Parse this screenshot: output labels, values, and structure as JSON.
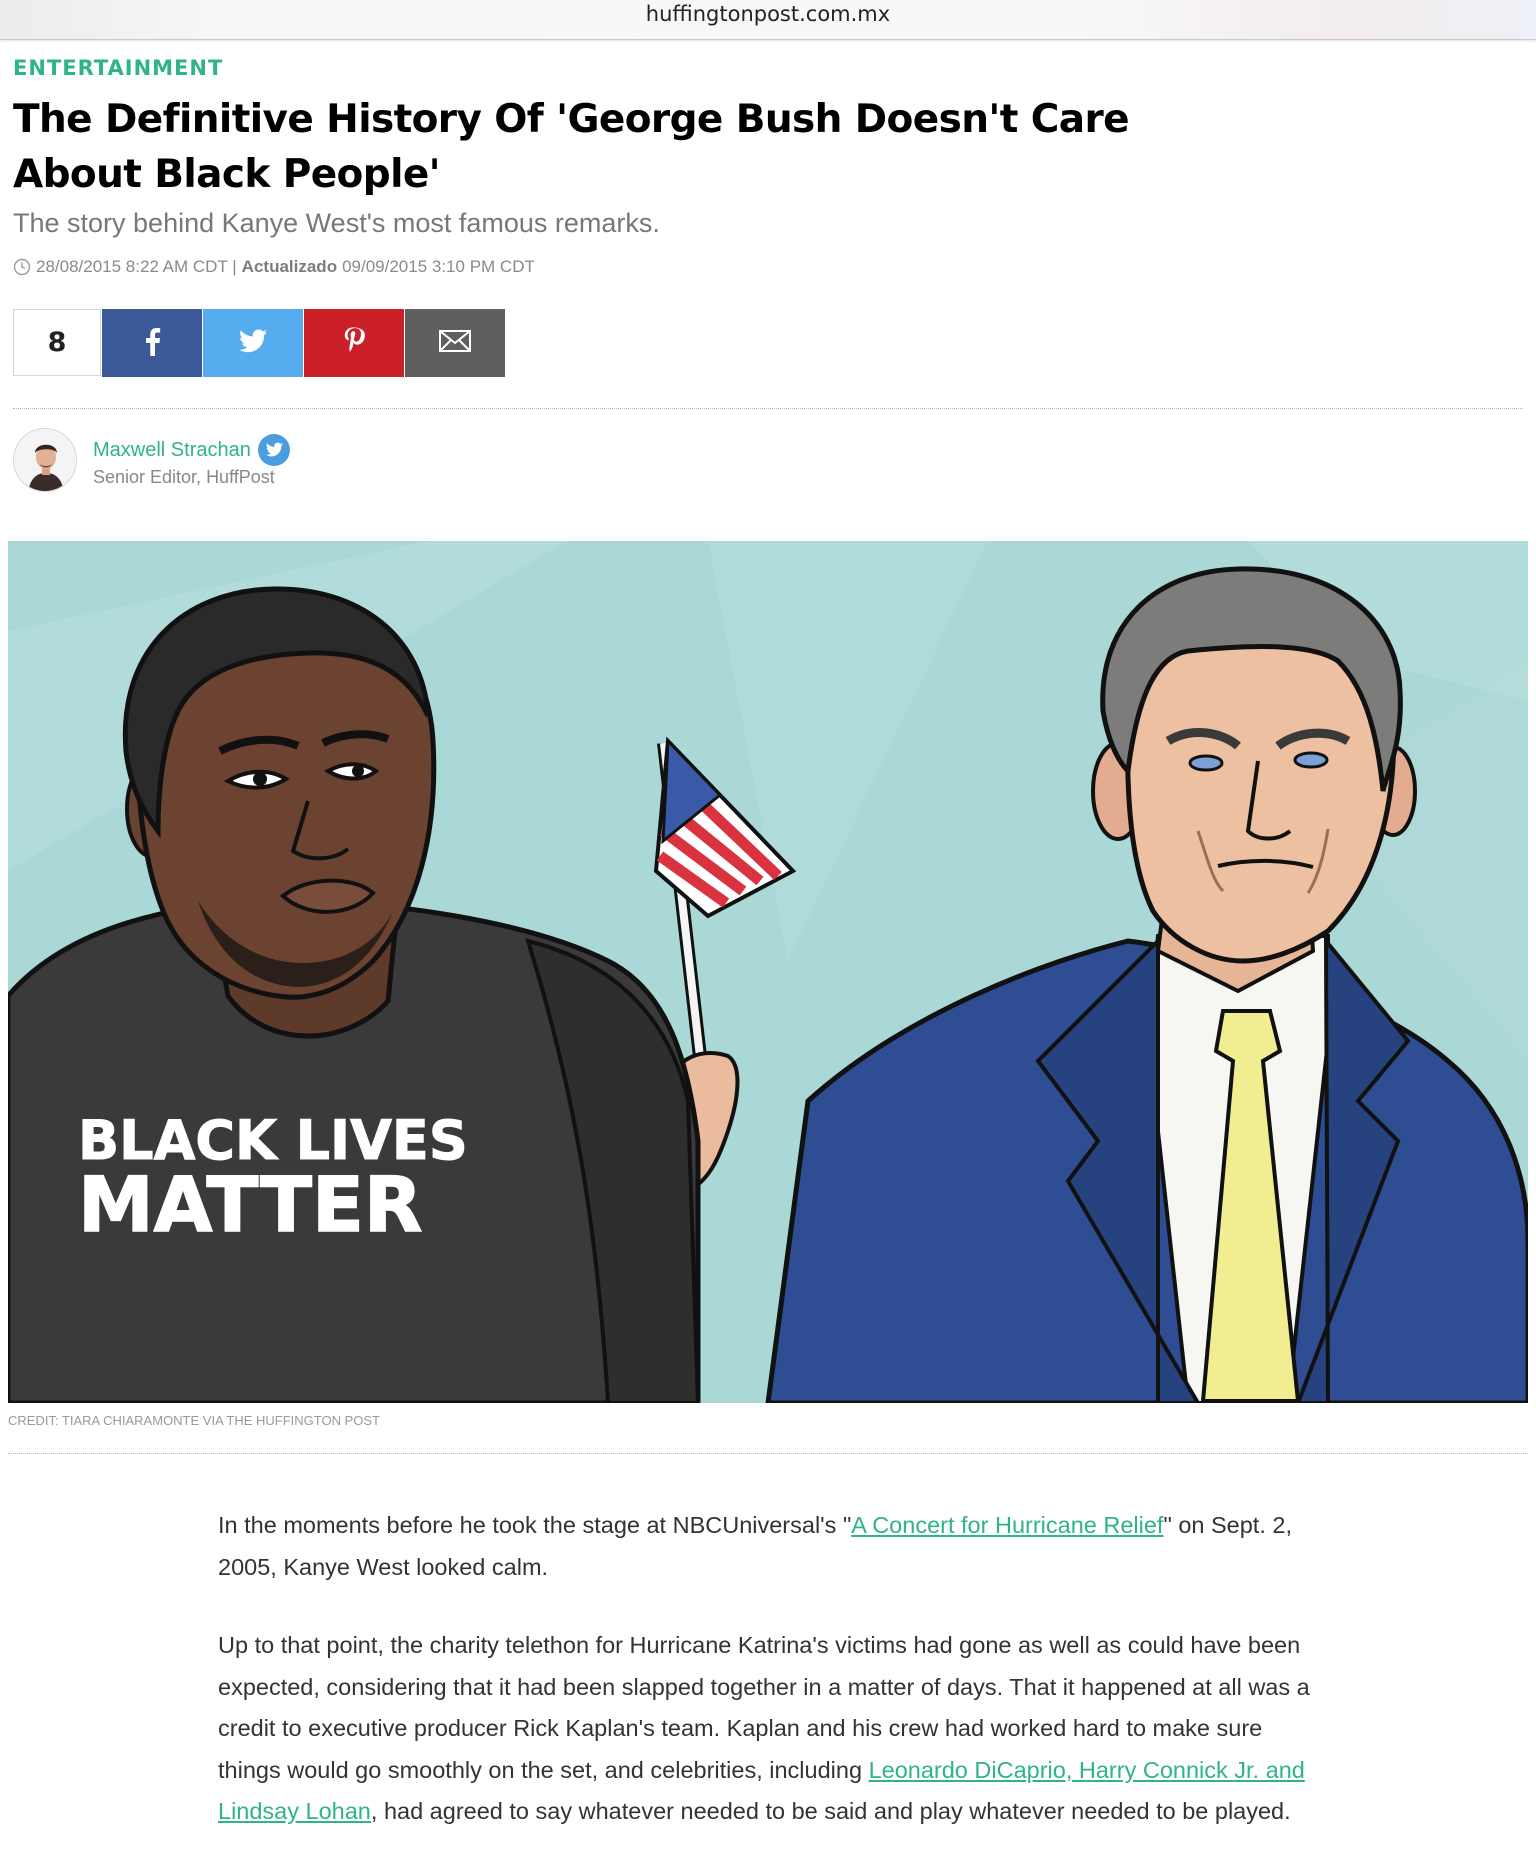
{
  "browser": {
    "url": "huffingtonpost.com.mx"
  },
  "article": {
    "section": "ENTERTAINMENT",
    "title": "The Definitive History Of 'George Bush Doesn't Care About Black People'",
    "subtitle": "The story behind Kanye West's most famous remarks.",
    "published": "28/08/2015 8:22 AM CDT |",
    "updated_label": "Actualizado",
    "updated": "09/09/2015 3:10 PM CDT"
  },
  "share": {
    "count": "8",
    "buttons": [
      {
        "name": "facebook",
        "icon": "facebook-icon",
        "color": "#3b5998"
      },
      {
        "name": "twitter",
        "icon": "twitter-icon",
        "color": "#55acee"
      },
      {
        "name": "pinterest",
        "icon": "pinterest-icon",
        "color": "#cb2027"
      },
      {
        "name": "email",
        "icon": "mail-icon",
        "color": "#5f5f5f"
      }
    ]
  },
  "author": {
    "name": "Maxwell Strachan",
    "role": "Senior Editor, HuffPost"
  },
  "hero": {
    "shirt_line1": "BLACK LIVES",
    "shirt_line2": "MATTER",
    "credit": "CREDIT: TIARA CHIARAMONTE VIA THE HUFFINGTON POST"
  },
  "body": {
    "p1_before": "In the moments before he took the stage at NBCUniversal's \"",
    "p1_link": "A Concert for Hurricane Relief",
    "p1_after": "\" on Sept. 2, 2005, Kanye West looked calm.",
    "p2_before": "Up to that point, the charity telethon for Hurricane Katrina's victims had gone as well as could have been expected, considering that it had been slapped together in a matter of days. That it happened at all was a credit to executive producer Rick Kaplan's team. Kaplan and his crew had worked hard to make sure things would go smoothly on the set, and celebrities, including ",
    "p2_link": "Leonardo DiCaprio, Harry Connick Jr. and Lindsay Lohan",
    "p2_after": ", had agreed to say whatever needed to be said and play whatever needed to be played."
  },
  "colors": {
    "accent": "#2fb38a",
    "hero_bg": "#a9d8d7"
  }
}
